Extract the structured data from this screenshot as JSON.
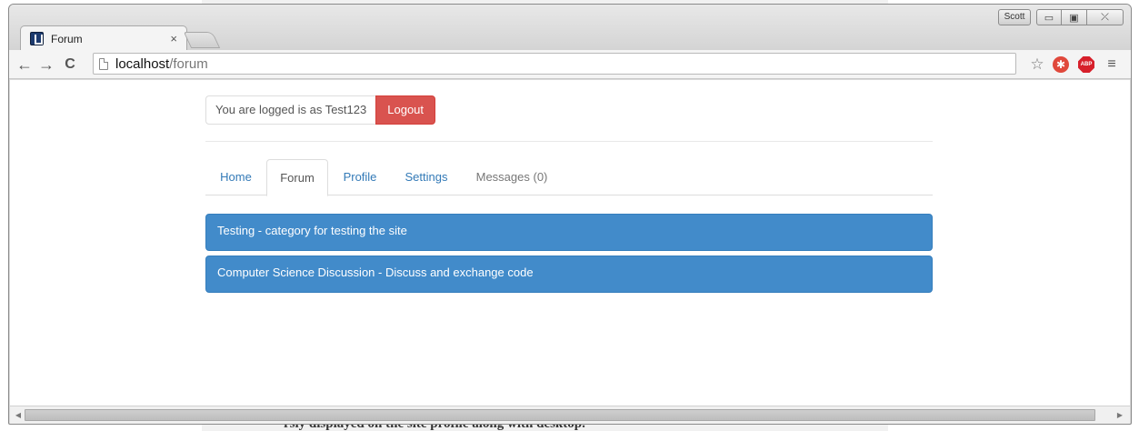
{
  "background": {
    "partial_text": "rsiy displayed on the site profile along with desktop."
  },
  "window": {
    "user_badge": "Scott",
    "controls": {
      "minimize": "▭",
      "maximize": "▣",
      "close": "⤫"
    }
  },
  "tab": {
    "title": "Forum",
    "close": "×"
  },
  "toolbar": {
    "back": "←",
    "forward": "→",
    "reload": "C",
    "url_host": "localhost",
    "url_path": "/forum",
    "star": "☆",
    "ext1": "✱",
    "abp": "ABP",
    "menu": "≡"
  },
  "page": {
    "login_text": "You are logged is as Test123",
    "logout_label": "Logout",
    "tabs": [
      {
        "label": "Home"
      },
      {
        "label": "Forum"
      },
      {
        "label": "Profile"
      },
      {
        "label": "Settings"
      },
      {
        "label": "Messages (0)"
      }
    ],
    "categories": [
      {
        "label": "Testing - category for testing the site"
      },
      {
        "label": "Computer Science Discussion - Discuss and exchange code"
      }
    ]
  },
  "scrollbar": {
    "left": "◀",
    "right": "▶"
  },
  "colors": {
    "danger": "#d9534f",
    "primary": "#428bca",
    "link": "#337ab7"
  }
}
